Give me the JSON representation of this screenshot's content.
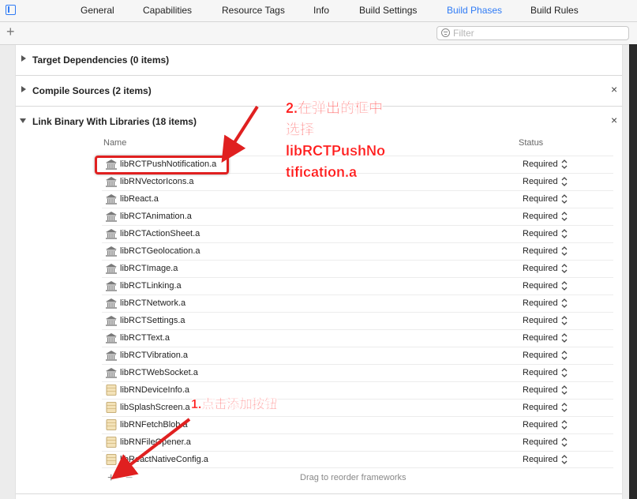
{
  "tabs": [
    {
      "label": "General"
    },
    {
      "label": "Capabilities"
    },
    {
      "label": "Resource Tags"
    },
    {
      "label": "Info"
    },
    {
      "label": "Build Settings"
    },
    {
      "label": "Build Phases",
      "active": true
    },
    {
      "label": "Build Rules"
    }
  ],
  "toolbar": {
    "add_label": "+",
    "filter_placeholder": "Filter"
  },
  "phases": {
    "target_dependencies": "Target Dependencies (0 items)",
    "compile_sources": "Compile Sources (2 items)",
    "link_binary": "Link Binary With Libraries (18 items)",
    "close_label": "×"
  },
  "table": {
    "col_name": "Name",
    "col_status": "Status",
    "rows": [
      {
        "name": "libRCTPushNotification.a",
        "status": "Required",
        "icon": "library-icon"
      },
      {
        "name": "libRNVectorIcons.a",
        "status": "Required",
        "icon": "library-icon"
      },
      {
        "name": "libReact.a",
        "status": "Required",
        "icon": "library-icon"
      },
      {
        "name": "libRCTAnimation.a",
        "status": "Required",
        "icon": "library-icon"
      },
      {
        "name": "libRCTActionSheet.a",
        "status": "Required",
        "icon": "library-icon"
      },
      {
        "name": "libRCTGeolocation.a",
        "status": "Required",
        "icon": "library-icon"
      },
      {
        "name": "libRCTImage.a",
        "status": "Required",
        "icon": "library-icon"
      },
      {
        "name": "libRCTLinking.a",
        "status": "Required",
        "icon": "library-icon"
      },
      {
        "name": "libRCTNetwork.a",
        "status": "Required",
        "icon": "library-icon"
      },
      {
        "name": "libRCTSettings.a",
        "status": "Required",
        "icon": "library-icon"
      },
      {
        "name": "libRCTText.a",
        "status": "Required",
        "icon": "library-icon"
      },
      {
        "name": "libRCTVibration.a",
        "status": "Required",
        "icon": "library-icon"
      },
      {
        "name": "libRCTWebSocket.a",
        "status": "Required",
        "icon": "library-icon"
      },
      {
        "name": "libRNDeviceInfo.a",
        "status": "Required",
        "icon": "archive-icon"
      },
      {
        "name": "libSplashScreen.a",
        "status": "Required",
        "icon": "archive-icon"
      },
      {
        "name": "libRNFetchBlob.a",
        "status": "Required",
        "icon": "archive-icon"
      },
      {
        "name": "libRNFileOpener.a",
        "status": "Required",
        "icon": "archive-icon"
      },
      {
        "name": "libReactNativeConfig.a",
        "status": "Required",
        "icon": "archive-icon"
      }
    ],
    "footer": {
      "add_label": "+",
      "remove_label": "−",
      "hint": "Drag to reorder frameworks"
    }
  },
  "annotations": {
    "step2_lines": [
      "2.在弹出的框中",
      "选择",
      "libRCTPushNo",
      "tification.a"
    ],
    "step1": "1.点击添加按钮"
  },
  "colors": {
    "accent": "#2f7bf5",
    "annotation": "#ff1a1a"
  }
}
